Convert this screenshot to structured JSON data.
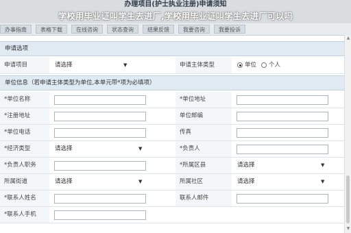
{
  "header": {
    "doc_title": "办理项目(护士执业注册)申请须知",
    "watermark": "学校用毕业证叫学生去进厂,学校用毕业证叫学生去进厂可以吗"
  },
  "tabs": [
    {
      "label": "办事指南"
    },
    {
      "label": "表格下载"
    },
    {
      "label": "在线咨询"
    },
    {
      "label": "状态查询"
    },
    {
      "label": "结果反馈"
    },
    {
      "label": "我要咨询"
    },
    {
      "label": "我要投诉"
    }
  ],
  "section1": {
    "title": "申请选项"
  },
  "apply_row": {
    "item_label": "申请项目",
    "item_value": "请选择",
    "subject_label": "申请主体类型",
    "opt_unit": "单位",
    "opt_person": "个人"
  },
  "section2": {
    "title": "单位信息（若申请主体类型为单位,本单元带*项为必填项）"
  },
  "form": {
    "unit_name": "*单位名称",
    "unit_address": "*单位地址",
    "reg_address": "*注册地址",
    "unit_zip": "单位邮编",
    "unit_phone": "*单位电话",
    "fax": "传真",
    "econ_type": "*经济类型",
    "econ_value": "请选择",
    "principal": "*负责人",
    "principal_title": "*负责人职务",
    "region": "*所属区县",
    "region_value": "请选择",
    "street": "所属街道",
    "street_value": "请选择",
    "community": "所属社区",
    "community_value": "请选择",
    "contact_name": "*联系人姓名",
    "contact_email": "联系人邮件",
    "contact_mobile": "*联系人手机"
  },
  "colors": {
    "section_bg": "#dfeaf2",
    "tab_bg": "#d5dde3"
  }
}
